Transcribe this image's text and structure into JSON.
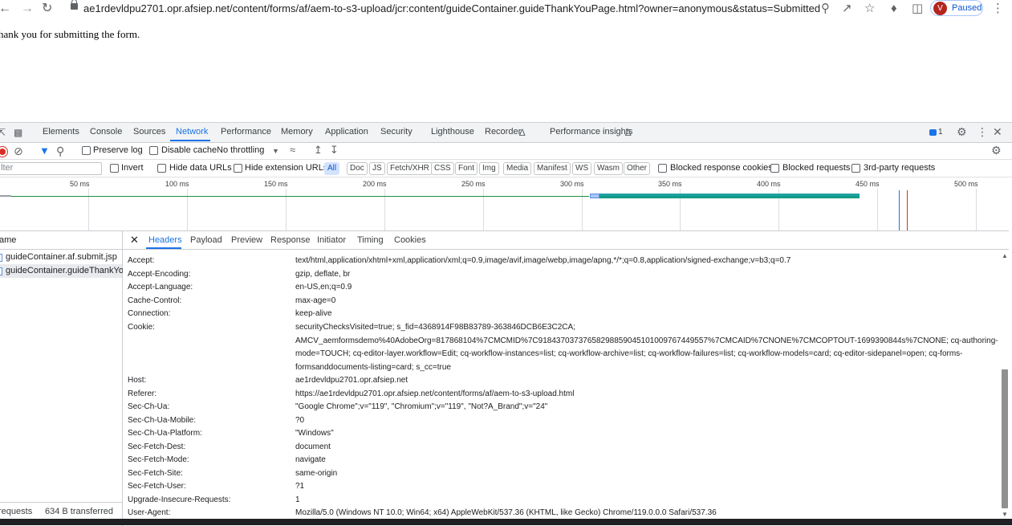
{
  "browser": {
    "url": "ae1rdevldpu2701.opr.afsiep.net/content/forms/af/aem-to-s3-upload/jcr:content/guideContainer.guideThankYouPage.html?owner=anonymous&status=Submitted",
    "profile": {
      "initial": "V",
      "status": "Paused"
    }
  },
  "page": {
    "message": "hank you for submitting the form."
  },
  "devtools": {
    "tabs": [
      "Elements",
      "Console",
      "Sources",
      "Network",
      "Performance",
      "Memory",
      "Application",
      "Security",
      "Lighthouse",
      "Recorder",
      "Performance insights"
    ],
    "issues_count": "1",
    "toolbar": {
      "preserve_log": "Preserve log",
      "disable_cache": "Disable cache",
      "throttling": "No throttling"
    },
    "filter": {
      "placeholder": "lter",
      "invert": "Invert",
      "hide_data_urls": "Hide data URLs",
      "hide_extension_urls": "Hide extension URLs",
      "types": [
        "All",
        "Doc",
        "JS",
        "Fetch/XHR",
        "CSS",
        "Font",
        "Img",
        "Media",
        "Manifest",
        "WS",
        "Wasm",
        "Other"
      ],
      "blocked_response_cookies": "Blocked response cookies",
      "blocked_requests": "Blocked requests",
      "third_party": "3rd-party requests"
    },
    "timeline": {
      "ticks": [
        "50 ms",
        "100 ms",
        "150 ms",
        "200 ms",
        "250 ms",
        "300 ms",
        "350 ms",
        "400 ms",
        "450 ms",
        "500 ms"
      ]
    },
    "requests": {
      "header": "ame",
      "items": [
        "guideContainer.af.submit.jsp",
        "guideContainer.guideThankYo..."
      ],
      "summary_requests": "requests",
      "summary_transferred": "634 B transferred"
    },
    "detail": {
      "tabs": [
        "Headers",
        "Payload",
        "Preview",
        "Response",
        "Initiator",
        "Timing",
        "Cookies"
      ],
      "headers": [
        {
          "key": "Accept:",
          "value": "text/html,application/xhtml+xml,application/xml;q=0.9,image/avif,image/webp,image/apng,*/*;q=0.8,application/signed-exchange;v=b3;q=0.7"
        },
        {
          "key": "Accept-Encoding:",
          "value": "gzip, deflate, br"
        },
        {
          "key": "Accept-Language:",
          "value": "en-US,en;q=0.9"
        },
        {
          "key": "Cache-Control:",
          "value": "max-age=0"
        },
        {
          "key": "Connection:",
          "value": "keep-alive"
        },
        {
          "key": "Cookie:",
          "lines": [
            "securityChecksVisited=true; s_fid=4368914F98B83789-363846DCB6E3C2CA;",
            "AMCV_aemformsdemo%40AdobeOrg=817868104%7CMCMID%7C918437037376582988590451010097674495​57%7CMCAID%7CNONE%7CMCOPTOUT-1699390844s%7CNONE; cq-authoring-",
            "mode=TOUCH; cq-editor-layer.workflow=Edit; cq-workflow-instances=list; cq-workflow-archive=list; cq-workflow-failures=list; cq-workflow-models=card; cq-editor-sidepanel=open; cq-forms-",
            "formsanddocuments-listing=card; s_cc=true"
          ]
        },
        {
          "key": "Host:",
          "value": "ae1rdevldpu2701.opr.afsiep.net"
        },
        {
          "key": "Referer:",
          "value": "https://ae1rdevldpu2701.opr.afsiep.net/content/forms/af/aem-to-s3-upload.html"
        },
        {
          "key": "Sec-Ch-Ua:",
          "value": "\"Google Chrome\";v=\"119\", \"Chromium\";v=\"119\", \"Not?A_Brand\";v=\"24\""
        },
        {
          "key": "Sec-Ch-Ua-Mobile:",
          "value": "?0"
        },
        {
          "key": "Sec-Ch-Ua-Platform:",
          "value": "\"Windows\""
        },
        {
          "key": "Sec-Fetch-Dest:",
          "value": "document"
        },
        {
          "key": "Sec-Fetch-Mode:",
          "value": "navigate"
        },
        {
          "key": "Sec-Fetch-Site:",
          "value": "same-origin"
        },
        {
          "key": "Sec-Fetch-User:",
          "value": "?1"
        },
        {
          "key": "Upgrade-Insecure-Requests:",
          "value": "1"
        },
        {
          "key": "User-Agent:",
          "value": "Mozilla/5.0 (Windows NT 10.0; Win64; x64) AppleWebKit/537.36 (KHTML, like Gecko) Chrome/119.0.0.0 Safari/537.36"
        }
      ]
    }
  }
}
